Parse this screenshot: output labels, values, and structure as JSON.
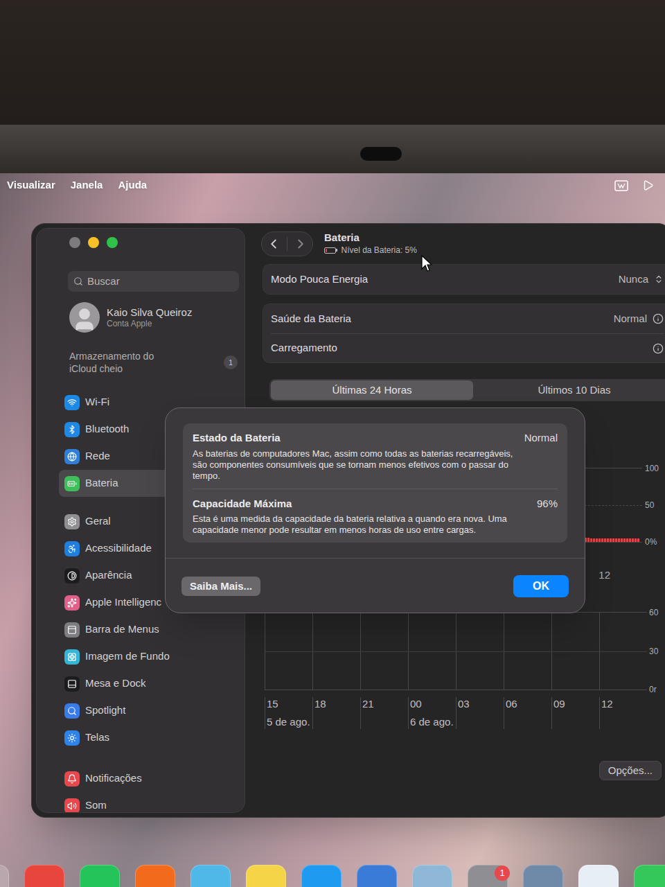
{
  "menu_bar": {
    "items": [
      "Visualizar",
      "Janela",
      "Ajuda"
    ]
  },
  "window": {
    "title": "Bateria",
    "subtitle": "Nível da Bateria: 5%",
    "battery_level": 0.05
  },
  "sidebar": {
    "search": {
      "placeholder": "Buscar"
    },
    "account": {
      "name": "Kaio Silva Queiroz",
      "subtitle": "Conta Apple"
    },
    "notice": {
      "text": "Armazenamento do iCloud cheio",
      "badge": "1"
    },
    "groups": [
      [
        {
          "label": "Wi-Fi",
          "selected": false,
          "color": "#1e88e5"
        },
        {
          "label": "Bluetooth",
          "selected": false,
          "color": "#1e88e5"
        },
        {
          "label": "Rede",
          "selected": false,
          "color": "#2f7fd8"
        },
        {
          "label": "Bateria",
          "selected": true,
          "color": "#3fbf5a"
        }
      ],
      [
        {
          "label": "Geral",
          "selected": false,
          "color": "#8e8e93"
        },
        {
          "label": "Acessibilidade",
          "selected": false,
          "color": "#1e7fe0"
        },
        {
          "label": "Aparência",
          "selected": false,
          "color": "#1c1c1e"
        },
        {
          "label": "Apple Intelligenc",
          "selected": false,
          "color": "#e0608a"
        },
        {
          "label": "Barra de Menus",
          "selected": false,
          "color": "#7d7d82"
        },
        {
          "label": "Imagem de Fundo",
          "selected": false,
          "color": "#35b6d6"
        },
        {
          "label": "Mesa e Dock",
          "selected": false,
          "color": "#1c1c1e"
        },
        {
          "label": "Spotlight",
          "selected": false,
          "color": "#3a7bea"
        },
        {
          "label": "Telas",
          "selected": false,
          "color": "#2f82e8"
        }
      ],
      [
        {
          "label": "Notificações",
          "selected": false,
          "color": "#e5484d"
        },
        {
          "label": "Som",
          "selected": false,
          "color": "#e5484d"
        }
      ]
    ]
  },
  "settings_groups": [
    [
      {
        "label": "Modo Pouca Energia",
        "value": "Nunca",
        "kind": "popup"
      }
    ],
    [
      {
        "label": "Saúde da Bateria",
        "value": "Normal",
        "kind": "info"
      },
      {
        "label": "Carregamento",
        "kind": "info"
      }
    ]
  ],
  "tabs": [
    {
      "label": "Últimas 24 Horas",
      "selected": true
    },
    {
      "label": "Últimos 10 Dias",
      "selected": false
    }
  ],
  "battery_chart": {
    "y_ticks": [
      "100",
      "50",
      "0%"
    ],
    "x_labels": [
      "12"
    ],
    "battery_level": [
      6,
      6,
      6,
      5,
      5,
      5,
      5,
      5,
      5,
      5,
      5,
      5,
      5,
      5,
      5,
      5,
      5,
      5,
      5,
      5,
      5
    ]
  },
  "screen_chart": {
    "y_ticks": [
      "60",
      "30",
      "0r"
    ],
    "x_labels": [
      {
        "label": "15",
        "date": "5 de ago."
      },
      {
        "label": "18"
      },
      {
        "label": "21"
      },
      {
        "label": "00",
        "date": "6 de ago."
      },
      {
        "label": "03"
      },
      {
        "label": "06"
      },
      {
        "label": "09"
      },
      {
        "label": "12"
      }
    ]
  },
  "options_button": "Opções...",
  "dialog": {
    "rows": [
      {
        "title": "Estado da Bateria",
        "value": "Normal",
        "description": "As baterias de computadores Mac, assim como todas as baterias recarregáveis, são componentes consumíveis que se tornam menos efetivos com o passar do tempo."
      },
      {
        "title": "Capacidade Máxima",
        "value": "96%",
        "description": "Esta é uma medida da capacidade da bateria relativa a quando era nova. Uma capacidade menor pode resultar em menos horas de uso entre cargas."
      }
    ],
    "buttons": [
      {
        "label": "Saiba Mais...",
        "kind": "secondary"
      },
      {
        "label": "OK",
        "kind": "primary"
      }
    ]
  },
  "dock": [
    {
      "color": "#b9a7ad"
    },
    {
      "color": "#e8453c"
    },
    {
      "color": "#25c45a"
    },
    {
      "color": "#f26b1d"
    },
    {
      "color": "#4fb8e8"
    },
    {
      "color": "#f5d547"
    },
    {
      "color": "#1e9bf0"
    },
    {
      "color": "#3b7bd8"
    },
    {
      "color": "#8fb7d6"
    },
    {
      "color": "#8e8e93",
      "badge": "1"
    },
    {
      "color": "#6f8aa8"
    },
    {
      "color": "#e8eef5"
    },
    {
      "color": "#34c759"
    }
  ]
}
